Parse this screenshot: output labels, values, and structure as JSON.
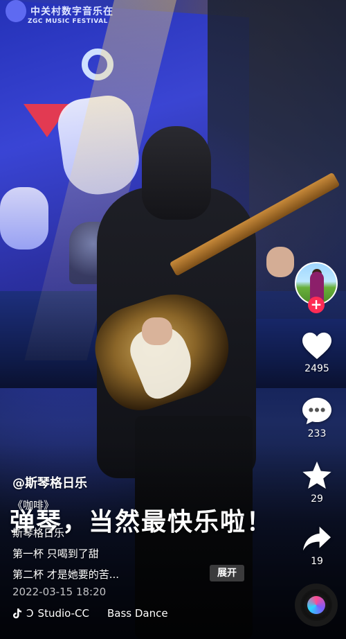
{
  "poster": {
    "title": "中关村数字音乐在",
    "subtitle": "ZGC MUSIC FESTIVAL"
  },
  "author": "@斯琴格日乐",
  "caption": "弹琴，当然最快乐啦！",
  "song_title": "《咖啡》",
  "description_lines": [
    "斯琴格日乐",
    "第一杯 只喝到了甜",
    "第二杯 才是她要的苦..."
  ],
  "expand_label": "展开",
  "date": "2022-03-15 18:20",
  "music": {
    "icon": "tiktok-note-icon",
    "artist": "Studio-CC",
    "track": "Bass Dance"
  },
  "rail": {
    "follow_symbol": "+",
    "like_count": "2495",
    "comment_count": "233",
    "favorite_count": "29",
    "share_count": "19"
  },
  "colors": {
    "accent": "#fe2c55",
    "text": "#ffffff"
  }
}
